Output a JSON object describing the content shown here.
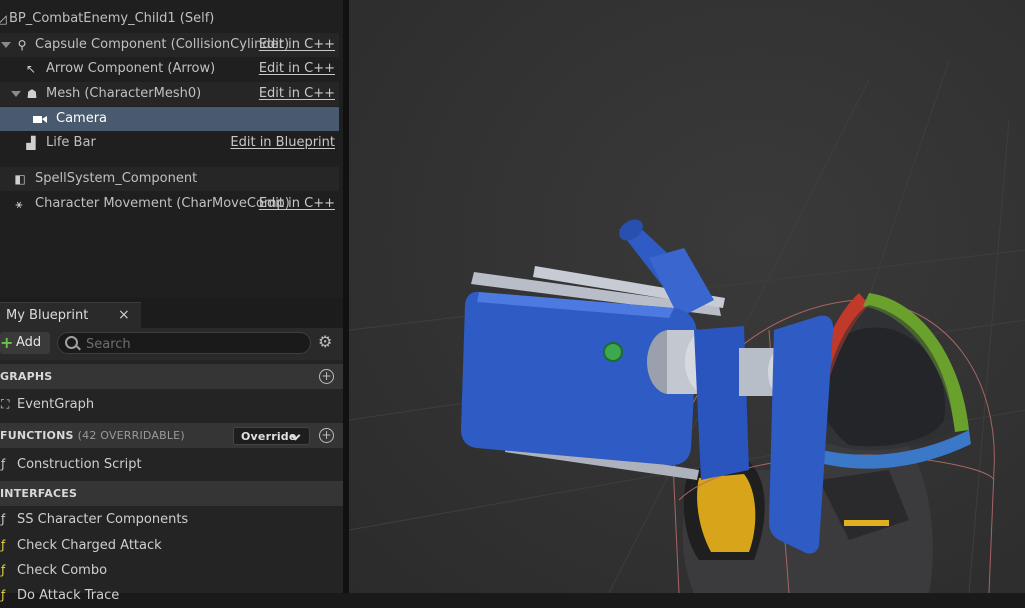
{
  "components": {
    "items": [
      {
        "label": "BP_CombatEnemy_Child1 (Self)",
        "action": "",
        "icon": "blueprint-self-icon"
      },
      {
        "label": "Capsule Component (CollisionCylinder)",
        "action": "Edit in C++",
        "icon": "capsule-icon"
      },
      {
        "label": "Arrow Component (Arrow)",
        "action": "Edit in C++",
        "icon": "arrow-component-icon"
      },
      {
        "label": "Mesh (CharacterMesh0)",
        "action": "Edit in C++",
        "icon": "skeletal-mesh-icon"
      },
      {
        "label": "Camera",
        "action": "",
        "icon": "camera-icon"
      },
      {
        "label": "Life Bar",
        "action": "Edit in Blueprint",
        "icon": "widget-icon"
      },
      {
        "label": "SpellSystem_Component",
        "action": "",
        "icon": "actor-component-icon"
      },
      {
        "label": "Character Movement (CharMoveComp)",
        "action": "Edit in C++",
        "icon": "movement-icon"
      }
    ]
  },
  "my_blueprint": {
    "tab_label": "My Blueprint",
    "close_symbol": "×",
    "add_label": "Add",
    "search_placeholder": "Search",
    "sections": {
      "graphs": {
        "title": "GRAPHS",
        "items": [
          "EventGraph"
        ]
      },
      "functions": {
        "title": "FUNCTIONS",
        "count_text": "(42 OVERRIDABLE)",
        "override_label": "Override",
        "items": [
          "Construction Script"
        ]
      },
      "interfaces": {
        "title": "INTERFACES",
        "items": [
          "SS Character Components",
          "Check Charged Attack",
          "Check Combo",
          "Do Attack Trace"
        ]
      }
    }
  },
  "colors": {
    "selection": "#4a5a6e",
    "add_green": "#6cc24a",
    "interface_yellow": "#e8d44d",
    "camera_blue": "#2f5bc4"
  }
}
